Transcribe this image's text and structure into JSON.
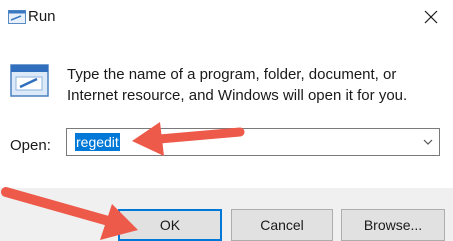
{
  "window": {
    "title": "Run",
    "close_glyph": "✕"
  },
  "body": {
    "description": "Type the name of a program, folder, document, or Internet resource, and Windows will open it for you."
  },
  "open_field": {
    "label": "Open:",
    "value": "regedit"
  },
  "buttons": {
    "ok": "OK",
    "cancel": "Cancel",
    "browse": "Browse..."
  },
  "colors": {
    "accent": "#0078d7",
    "annotation_arrow": "#ee5a4a"
  }
}
